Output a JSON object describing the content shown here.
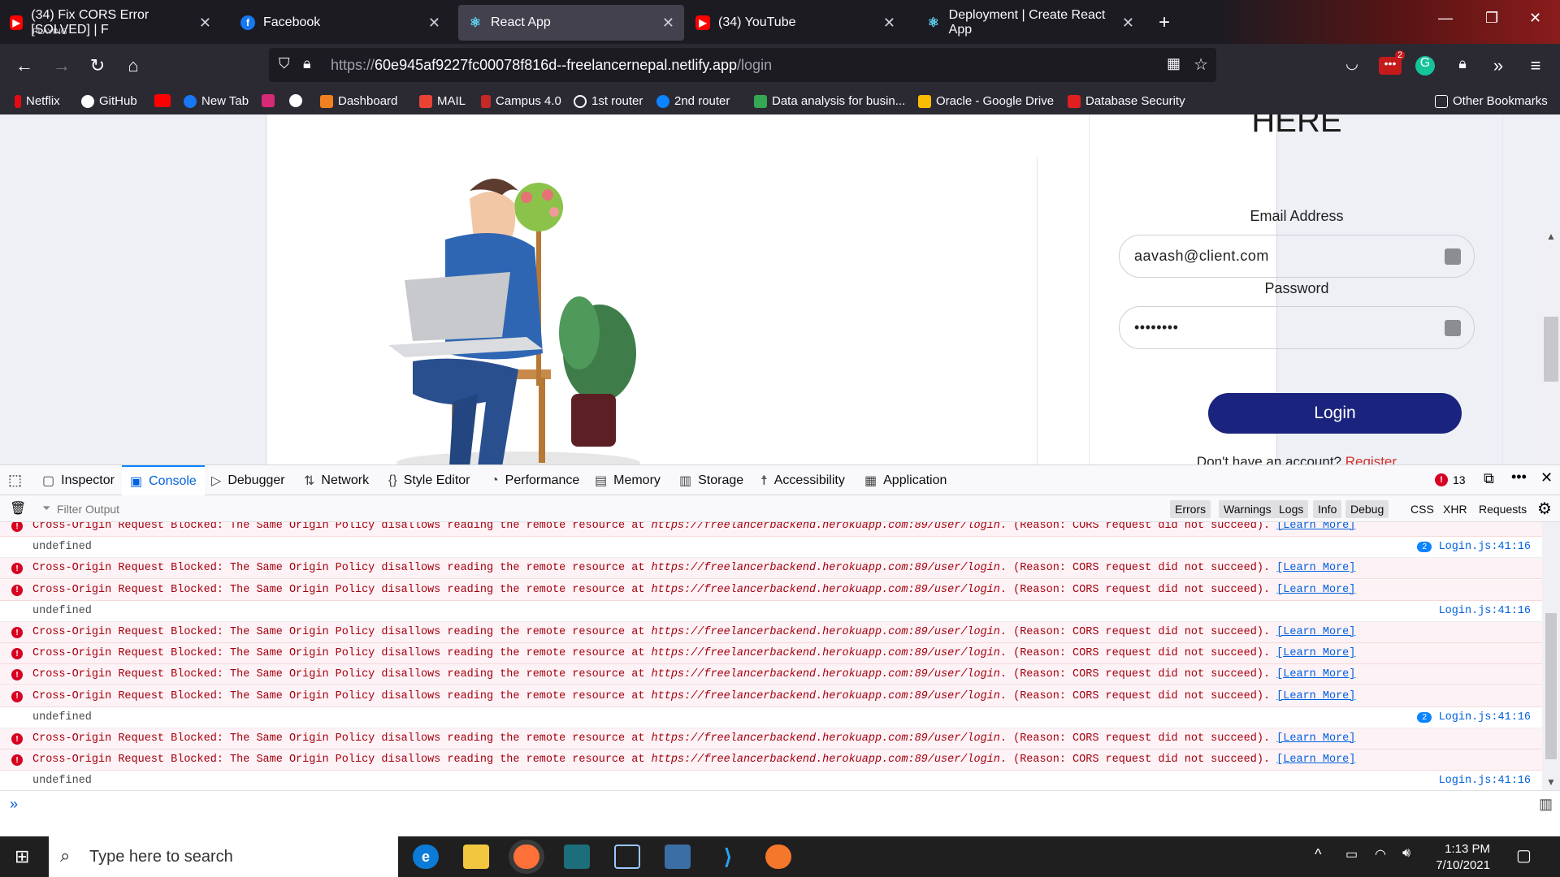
{
  "browser": {
    "tabs": [
      {
        "title": "(34) Fix CORS Error [SOLVED] | F",
        "sub": "PLAYING",
        "icon": "youtube-icon",
        "color": "#ff0000"
      },
      {
        "title": "Facebook",
        "icon": "facebook-icon",
        "color": "#1877f2"
      },
      {
        "title": "React App",
        "icon": "react-icon",
        "color": "#61dafb"
      },
      {
        "title": "(34) YouTube",
        "icon": "youtube-icon",
        "color": "#ff0000"
      },
      {
        "title": "Deployment | Create React App",
        "icon": "react-icon",
        "color": "#61dafb"
      }
    ],
    "new_tab": "+",
    "url_prefix": "https://",
    "url_host": "60e945af9227fc00078f816d--freelancernepal.netlify.app",
    "url_path": "/login",
    "extension_badge": "2",
    "bookmarks": [
      "Netflix",
      "GitHub",
      "New Tab",
      "Dashboard",
      "MAIL",
      "Campus 4.0",
      "1st router",
      "2nd router",
      "Data analysis for busin...",
      "Oracle - Google Drive",
      "Database Security"
    ],
    "other_bookmarks": "Other Bookmarks"
  },
  "page": {
    "heading": "HERE",
    "email_label": "Email Address",
    "email_value": "aavash@client.com",
    "password_label": "Password",
    "password_value": "••••••••",
    "login_label": "Login",
    "no_account": "Don't have an account?",
    "register": "Register",
    "brand_color": "#1a237e"
  },
  "devtools": {
    "tabs": [
      "Inspector",
      "Console",
      "Debugger",
      "Network",
      "Style Editor",
      "Performance",
      "Memory",
      "Storage",
      "Accessibility",
      "Application"
    ],
    "selected_tab": "Console",
    "error_count": "13",
    "filter_placeholder": "Filter Output",
    "filters": [
      "Errors",
      "Warnings",
      "Logs",
      "Info",
      "Debug"
    ],
    "extra_filters": [
      "CSS",
      "XHR",
      "Requests"
    ],
    "error_prefix": "Cross-Origin Request Blocked: The Same Origin Policy disallows reading the remote resource at ",
    "error_url": "https://freelancerbackend.herokuapp.com:89/user/login",
    "error_suffix": ". (Reason: CORS request did not succeed). ",
    "learn_more": "[Learn More]",
    "log_text": "undefined",
    "log_source": "Login.js:41:16",
    "rows": [
      {
        "type": "err"
      },
      {
        "type": "log",
        "repeat": "2"
      },
      {
        "type": "err"
      },
      {
        "type": "err"
      },
      {
        "type": "log",
        "repeat": ""
      },
      {
        "type": "err"
      },
      {
        "type": "err"
      },
      {
        "type": "err"
      },
      {
        "type": "err"
      },
      {
        "type": "log",
        "repeat": "2"
      },
      {
        "type": "err"
      },
      {
        "type": "err"
      },
      {
        "type": "log",
        "repeat": ""
      }
    ],
    "prompt": "»"
  },
  "taskbar": {
    "search_placeholder": "Type here to search",
    "time": "1:13 PM",
    "date": "7/10/2021"
  }
}
